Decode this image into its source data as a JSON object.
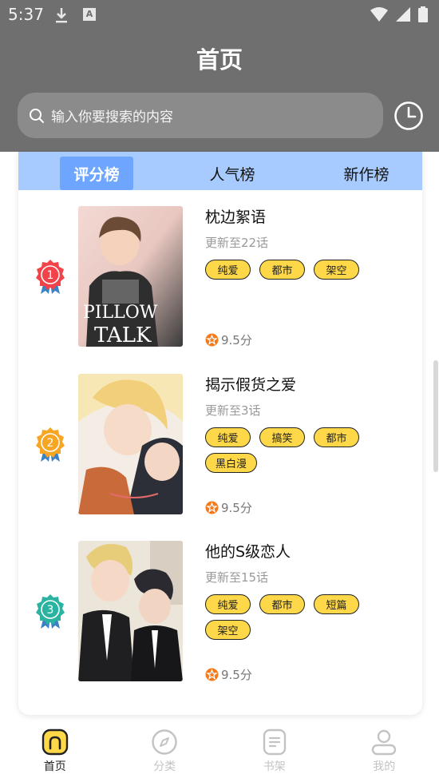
{
  "status_bar": {
    "time": "5:37",
    "notification_icons": [
      "download-icon",
      "a-icon"
    ],
    "system_icons": [
      "wifi-icon",
      "signal-icon",
      "battery-icon"
    ]
  },
  "header": {
    "title": "首页"
  },
  "search": {
    "placeholder": "输入你要搜索的内容"
  },
  "tabs": [
    {
      "label": "评分榜",
      "active": true
    },
    {
      "label": "人气榜",
      "active": false
    },
    {
      "label": "新作榜",
      "active": false
    }
  ],
  "rankings": [
    {
      "rank": "1",
      "title": "枕边絮语",
      "update": "更新至22话",
      "tags": [
        "纯爱",
        "都市",
        "架空"
      ],
      "score": "9.5分",
      "cover_text": "PILLOW TALK"
    },
    {
      "rank": "2",
      "title": "揭示假货之爱",
      "update": "更新至3话",
      "tags": [
        "纯爱",
        "搞笑",
        "都市",
        "黑白漫"
      ],
      "score": "9.5分"
    },
    {
      "rank": "3",
      "title": "他的S级恋人",
      "update": "更新至15话",
      "tags": [
        "纯爱",
        "都市",
        "短篇",
        "架空"
      ],
      "score": "9.5分"
    }
  ],
  "bottom_nav": [
    {
      "label": "首页",
      "icon": "home-icon",
      "active": true
    },
    {
      "label": "分类",
      "icon": "compass-icon",
      "active": false
    },
    {
      "label": "书架",
      "icon": "bookshelf-icon",
      "active": false
    },
    {
      "label": "我的",
      "icon": "profile-icon",
      "active": false
    }
  ],
  "colors": {
    "accent": "#6ea6ff",
    "tab_bar": "#a8cbff",
    "tag_fill": "#ffd84a",
    "rank_1": "#f0444a",
    "rank_2": "#f6a623",
    "rank_3": "#2ab3a0",
    "score_icon": "#f37b1d"
  }
}
